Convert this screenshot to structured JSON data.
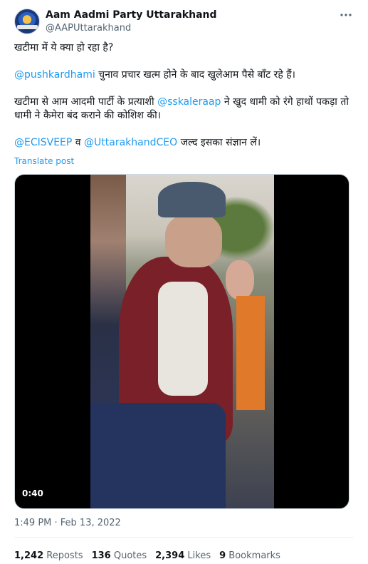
{
  "account": {
    "name": "Aam Aadmi Party Uttarakhand",
    "handle": "@AAPUttarakhand",
    "more_icon": "more-icon"
  },
  "tweet": {
    "line1": "खटीमा में ये क्या हो रहा है?",
    "mention1": "@pushkardhami",
    "line2_rest": " चुनाव प्रचार खत्म होने के बाद खुलेआम पैसे बाँट रहे हैं।",
    "line3_start": "खटीमा से आम आदमी पार्टी के प्रत्याशी ",
    "mention2": "@sskaleraap",
    "line3_rest": " ने खुद धामी को रंगे हाथों पकड़ा तो धामी ने कैमेरा बंद कराने की कोशिश की।",
    "mention3": "@ECISVEEP",
    "connector": " व ",
    "mention4": "@UttarakhandCEO",
    "line4_rest": " जल्द इसका संज्ञान लें।",
    "translate_label": "Translate post"
  },
  "media": {
    "duration": "0:40"
  },
  "meta": {
    "date": "1:49 PM · Feb 13, 2022"
  },
  "stats": {
    "reposts_count": "1,242",
    "reposts_label": "Reposts",
    "quotes_count": "136",
    "quotes_label": "Quotes",
    "likes_count": "2,394",
    "likes_label": "Likes",
    "bookmarks_count": "9",
    "bookmarks_label": "Bookmarks"
  }
}
